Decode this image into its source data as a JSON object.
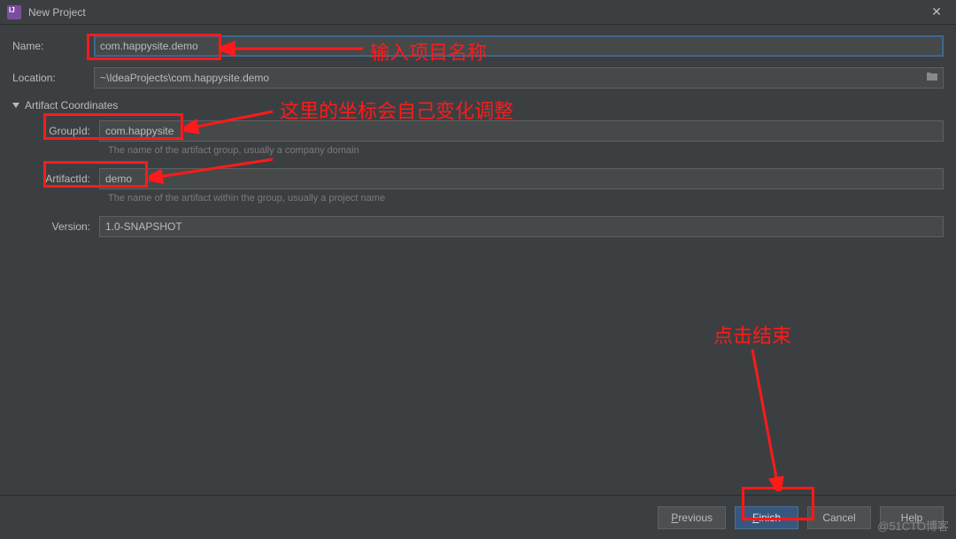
{
  "window": {
    "title": "New Project"
  },
  "form": {
    "name_label": "Name:",
    "name_value": "com.happysite.demo",
    "location_label": "Location:",
    "location_value": "~\\IdeaProjects\\com.happysite.demo"
  },
  "artifact": {
    "section_title": "Artifact Coordinates",
    "group_label": "GroupId:",
    "group_value": "com.happysite",
    "group_hint": "The name of the artifact group, usually a company domain",
    "artifact_label": "ArtifactId:",
    "artifact_value": "demo",
    "artifact_hint": "The name of the artifact within the group, usually a project name",
    "version_label": "Version:",
    "version_value": "1.0-SNAPSHOT"
  },
  "footer": {
    "previous": "Previous",
    "finish": "Finish",
    "cancel": "Cancel",
    "help": "Help"
  },
  "annotations": {
    "name_hint": "输入项目名称",
    "coord_hint": "这里的坐标会自己变化调整",
    "finish_hint": "点击结束"
  },
  "watermark": "@51CTO博客"
}
